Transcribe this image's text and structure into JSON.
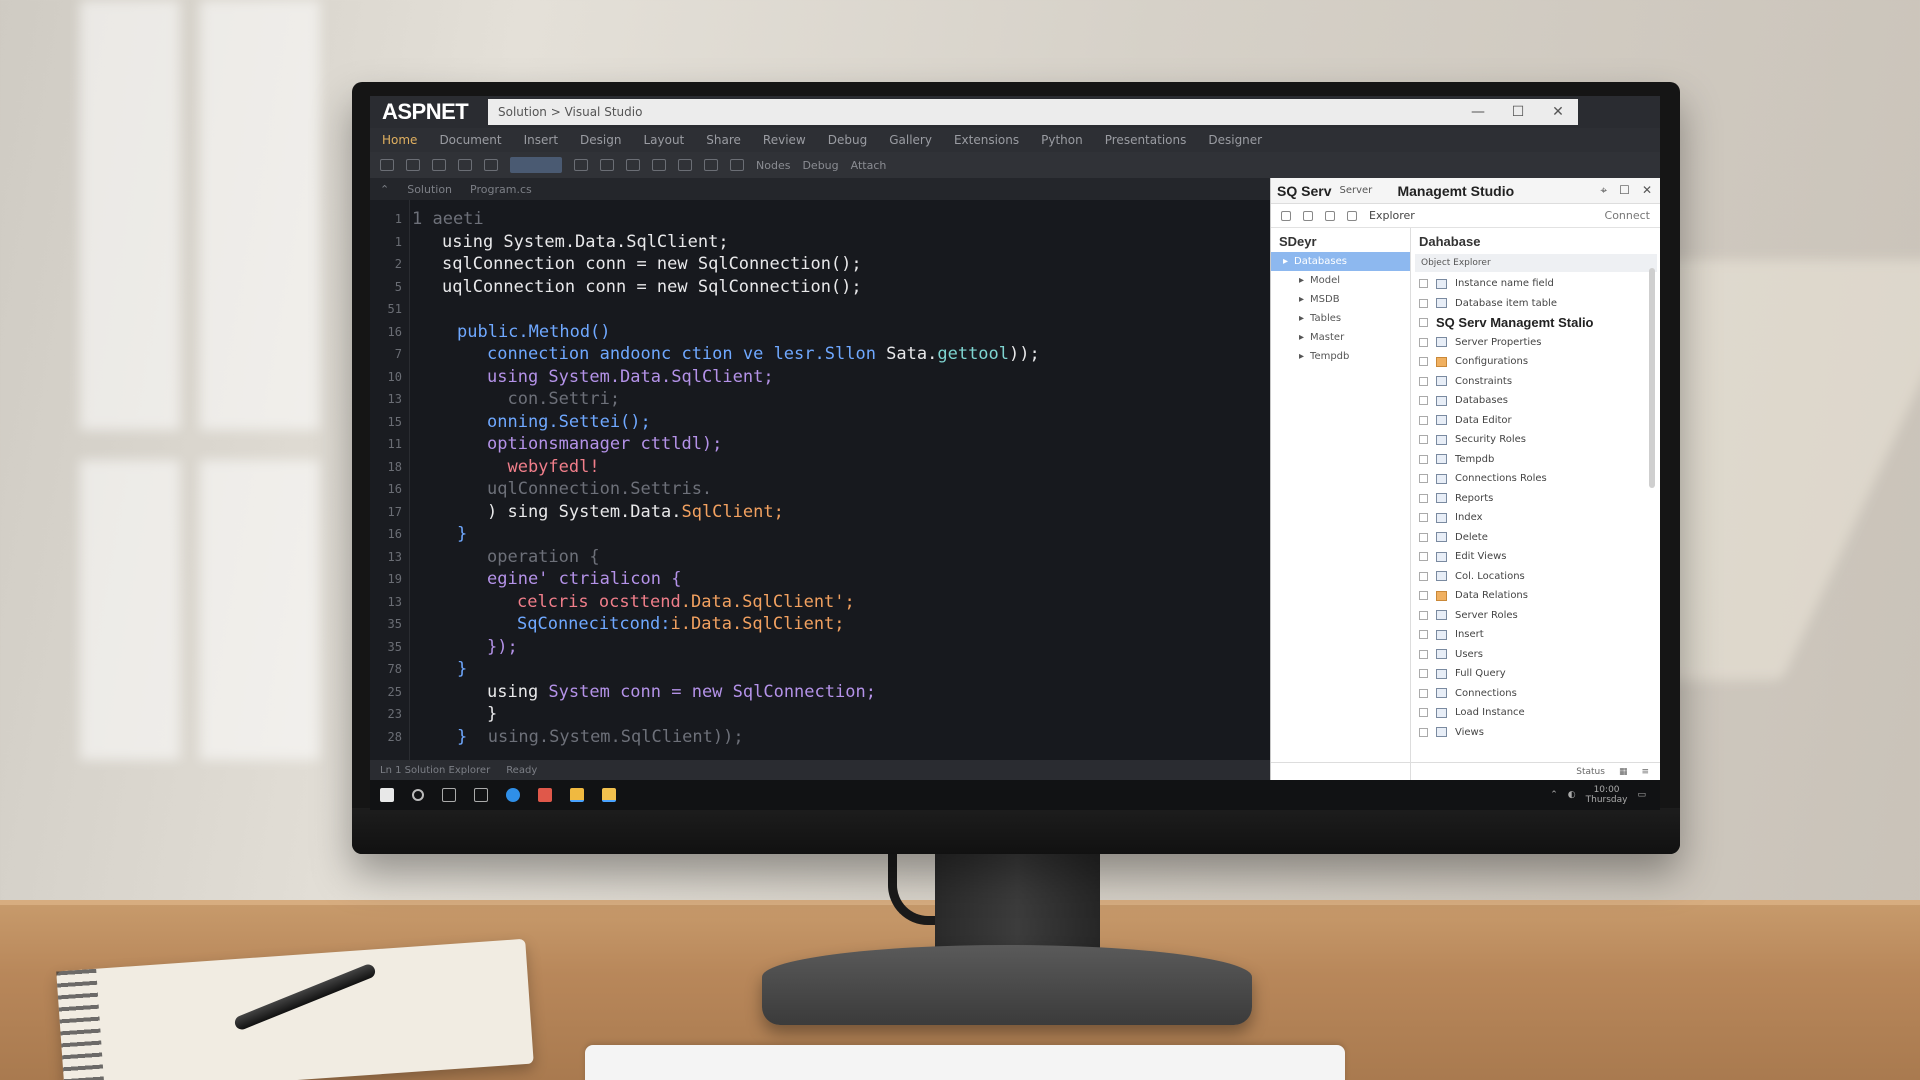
{
  "titlebar": {
    "app_logo": "ASPNET",
    "tab_title": "Solution > Visual Studio",
    "minimize": "—",
    "maximize": "☐",
    "close": "✕"
  },
  "menu": [
    "Home",
    "Document",
    "Insert",
    "Design",
    "Layout",
    "Share",
    "Review",
    "Debug",
    "Gallery",
    "Extensions",
    "Python",
    "Presentations",
    "Designer"
  ],
  "toolbar": {
    "label1": "Nodes",
    "label2": "Debug",
    "label3": "Attach"
  },
  "editor_tabs": [
    "Solution",
    "Program.cs"
  ],
  "code_lines": [
    {
      "ln": "1",
      "segments": [
        {
          "t": "1 aeeti",
          "c": "gray"
        }
      ],
      "indent": 0
    },
    {
      "ln": "1",
      "segments": [
        {
          "t": "using System.Data.SqlClient;",
          "c": "white"
        }
      ],
      "indent": 2
    },
    {
      "ln": "2",
      "segments": [
        {
          "t": "sqlConnection conn = new SqlConnection();",
          "c": "white"
        }
      ],
      "indent": 2
    },
    {
      "ln": "5",
      "segments": [
        {
          "t": "uqlConnection conn = new SqlConnection();",
          "c": "white"
        }
      ],
      "indent": 2
    },
    {
      "ln": "51",
      "segments": [
        {
          "t": "",
          "c": "gray"
        }
      ],
      "indent": 3
    },
    {
      "ln": "16",
      "segments": [
        {
          "t": "public.Method()",
          "c": "blue"
        }
      ],
      "indent": 3
    },
    {
      "ln": "7",
      "segments": [
        {
          "t": "connection andoonc ction ve lesr.Sllon ",
          "c": "blue"
        },
        {
          "t": "Sata.",
          "c": "white"
        },
        {
          "t": "gettool",
          "c": "teal"
        },
        {
          "t": "));",
          "c": "white"
        }
      ],
      "indent": 5
    },
    {
      "ln": "10",
      "segments": [
        {
          "t": "using System.Data.",
          "c": "purple"
        },
        {
          "t": "SqlClient;",
          "c": "purple"
        }
      ],
      "indent": 5
    },
    {
      "ln": "13",
      "segments": [
        {
          "t": "  con.Settri;",
          "c": "gray"
        }
      ],
      "indent": 5
    },
    {
      "ln": "15",
      "segments": [
        {
          "t": "onning.Settei();",
          "c": "blue"
        }
      ],
      "indent": 5
    },
    {
      "ln": "11",
      "segments": [
        {
          "t": "optionsmanager cttldl);",
          "c": "purple"
        }
      ],
      "indent": 5
    },
    {
      "ln": "18",
      "segments": [
        {
          "t": "  webyfedl!",
          "c": "pink"
        }
      ],
      "indent": 5
    },
    {
      "ln": "16",
      "segments": [
        {
          "t": "uqlConnection.Settris.",
          "c": "gray"
        }
      ],
      "indent": 5
    },
    {
      "ln": "17",
      "segments": [
        {
          "t": ") sing System.Data.",
          "c": "white"
        },
        {
          "t": "SqlClient;",
          "c": "orange"
        }
      ],
      "indent": 5
    },
    {
      "ln": "16",
      "segments": [
        {
          "t": "}",
          "c": "blue"
        }
      ],
      "indent": 3
    },
    {
      "ln": "13",
      "segments": [
        {
          "t": "operation {",
          "c": "gray"
        }
      ],
      "indent": 5
    },
    {
      "ln": "19",
      "segments": [
        {
          "t": "egine' ctrialicon {",
          "c": "purple"
        }
      ],
      "indent": 5
    },
    {
      "ln": "13",
      "segments": [
        {
          "t": "celcris ocsttend",
          "c": "pink"
        },
        {
          "t": ".Data.SqlClient';",
          "c": "orange"
        }
      ],
      "indent": 7
    },
    {
      "ln": "35",
      "segments": [
        {
          "t": "SqConnecitcond:",
          "c": "blue"
        },
        {
          "t": "i.Data.SqlClient;",
          "c": "orange"
        }
      ],
      "indent": 7
    },
    {
      "ln": "35",
      "segments": [
        {
          "t": "});",
          "c": "purple"
        }
      ],
      "indent": 5
    },
    {
      "ln": "78",
      "segments": [
        {
          "t": "}",
          "c": "blue"
        }
      ],
      "indent": 3
    },
    {
      "ln": "25",
      "segments": [
        {
          "t": "using ",
          "c": "white"
        },
        {
          "t": "System conn = new SqlConnection;",
          "c": "purple"
        }
      ],
      "indent": 5
    },
    {
      "ln": "23",
      "segments": [
        {
          "t": "}",
          "c": "white"
        }
      ],
      "indent": 5
    },
    {
      "ln": "28",
      "segments": [
        {
          "t": "}  ",
          "c": "blue"
        },
        {
          "t": "using.System.SqlClient));",
          "c": "gray"
        }
      ],
      "indent": 3
    }
  ],
  "status": {
    "left": "Ln 1   Solution Explorer",
    "right": "Ready"
  },
  "ssms": {
    "title_main": "SQ Serv",
    "title_sub": "Server",
    "title_app": "Managemt Studio",
    "toolbar_label": "Explorer",
    "toolbar_right": "Connect",
    "left_header": "SDeyr",
    "right_header": "Dahabase",
    "tree": [
      {
        "label": "Databases",
        "selected": true,
        "indent": false
      },
      {
        "label": "Model",
        "selected": false,
        "indent": true
      },
      {
        "label": "MSDB",
        "selected": false,
        "indent": true
      },
      {
        "label": "Tables",
        "selected": false,
        "indent": true
      },
      {
        "label": "Master",
        "selected": false,
        "indent": true
      },
      {
        "label": "Tempdb",
        "selected": false,
        "indent": true
      }
    ],
    "db_header": "Object Explorer",
    "db_items": [
      {
        "label": "Instance name field",
        "icon": "plain",
        "big": false
      },
      {
        "label": "Database item table",
        "icon": "plain",
        "big": false
      },
      {
        "label": "SQ Serv Managemt Stalio",
        "icon": "none",
        "big": true
      },
      {
        "label": "Server Properties",
        "icon": "plain",
        "big": false
      },
      {
        "label": "Configurations",
        "icon": "orange",
        "big": false
      },
      {
        "label": "Constraints",
        "icon": "plain",
        "big": false
      },
      {
        "label": "Databases",
        "icon": "plain",
        "big": false
      },
      {
        "label": "Data Editor",
        "icon": "plain",
        "big": false
      },
      {
        "label": "Security Roles",
        "icon": "plain",
        "big": false
      },
      {
        "label": "Tempdb",
        "icon": "plain",
        "big": false
      },
      {
        "label": "Connections Roles",
        "icon": "plain",
        "big": false
      },
      {
        "label": "Reports",
        "icon": "plain",
        "big": false
      },
      {
        "label": "Index",
        "icon": "plain",
        "big": false
      },
      {
        "label": "Delete",
        "icon": "plain",
        "big": false
      },
      {
        "label": "Edit Views",
        "icon": "plain",
        "big": false
      },
      {
        "label": "Col. Locations",
        "icon": "plain",
        "big": false
      },
      {
        "label": "Data Relations",
        "icon": "orange",
        "big": false
      },
      {
        "label": "Server Roles",
        "icon": "plain",
        "big": false
      },
      {
        "label": "Insert",
        "icon": "plain",
        "big": false
      },
      {
        "label": "Users",
        "icon": "plain",
        "big": false
      },
      {
        "label": "Full Query",
        "icon": "plain",
        "big": false
      },
      {
        "label": "Connections",
        "icon": "plain",
        "big": false
      },
      {
        "label": "Load Instance",
        "icon": "plain",
        "big": false
      },
      {
        "label": "Views",
        "icon": "plain",
        "big": false
      }
    ],
    "bottom_label": "Status"
  },
  "taskbar": {
    "time": "10:00",
    "date": "Thursday"
  },
  "colors": {
    "code_white": "#e8e8ea",
    "code_purple": "#b492e8",
    "code_blue": "#6fa8ff",
    "code_orange": "#f2a160",
    "selection": "#8db8ef"
  }
}
